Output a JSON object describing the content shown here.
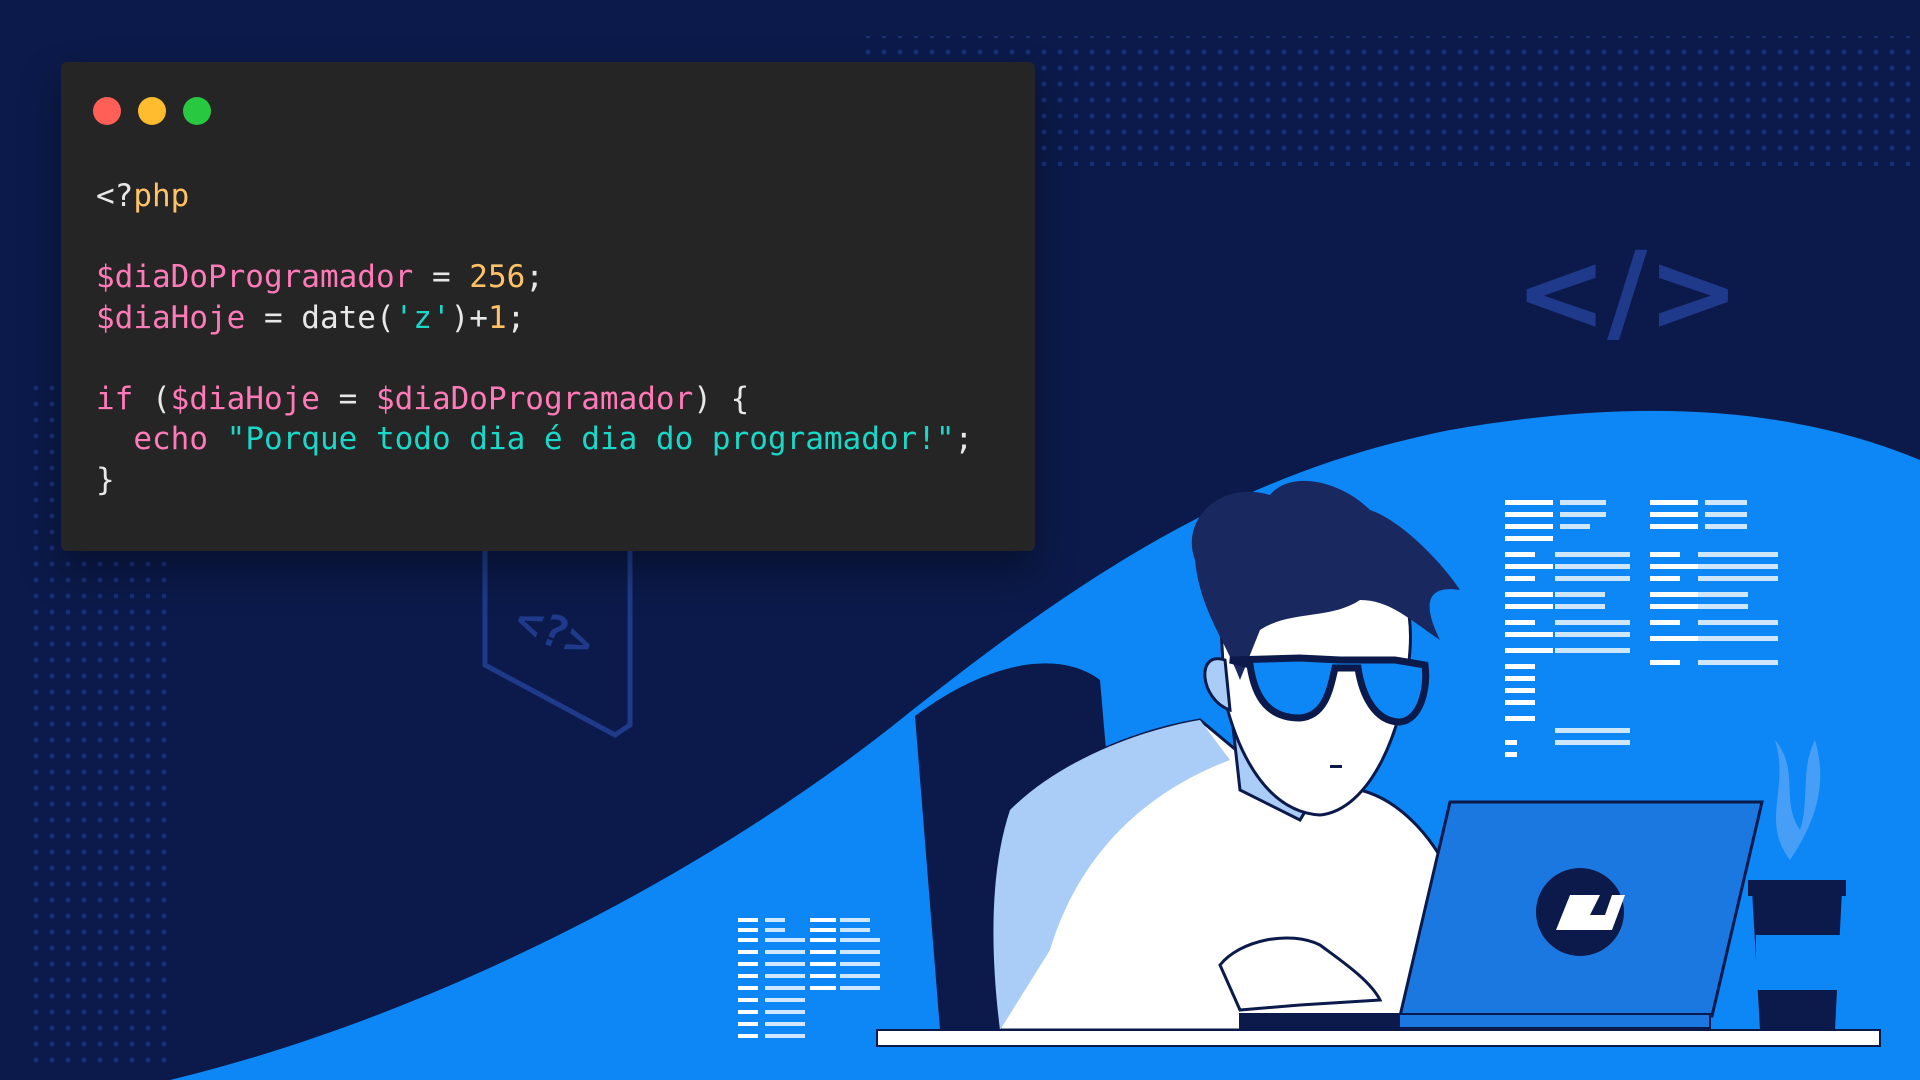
{
  "colors": {
    "background_dark": "#0b1a4a",
    "background_blue": "#0c87f5",
    "code_window_bg": "#252526",
    "dot_red": "#ff5f57",
    "dot_yellow": "#febc2e",
    "dot_green": "#28c840",
    "code_default": "#e8e8e8",
    "code_keyword": "#ff7ab6",
    "code_variable": "#ff7ab6",
    "code_number": "#ffc266",
    "code_string": "#19d8c8",
    "code_tag": "#ffc266"
  },
  "icons": [
    "close-dot-icon",
    "minimize-dot-icon",
    "maximize-dot-icon",
    "code-brackets-icon",
    "php-file-icon",
    "brand-logo-icon",
    "coffee-cup-icon"
  ],
  "code_window": {
    "lines": [
      [
        {
          "t": "<?",
          "c": "code_default"
        },
        {
          "t": "php",
          "c": "code_tag"
        }
      ],
      [],
      [
        {
          "t": "$diaDoProgramador",
          "c": "code_variable"
        },
        {
          "t": " = ",
          "c": "code_default"
        },
        {
          "t": "256",
          "c": "code_number"
        },
        {
          "t": ";",
          "c": "code_default"
        }
      ],
      [
        {
          "t": "$diaHoje",
          "c": "code_variable"
        },
        {
          "t": " = date(",
          "c": "code_default"
        },
        {
          "t": "'z'",
          "c": "code_string"
        },
        {
          "t": ")+",
          "c": "code_default"
        },
        {
          "t": "1",
          "c": "code_number"
        },
        {
          "t": ";",
          "c": "code_default"
        }
      ],
      [],
      [
        {
          "t": "if",
          "c": "code_keyword"
        },
        {
          "t": " (",
          "c": "code_default"
        },
        {
          "t": "$diaHoje",
          "c": "code_variable"
        },
        {
          "t": " = ",
          "c": "code_default"
        },
        {
          "t": "$diaDoProgramador",
          "c": "code_variable"
        },
        {
          "t": ") {",
          "c": "code_default"
        }
      ],
      [
        {
          "t": "  ",
          "c": "code_default"
        },
        {
          "t": "echo",
          "c": "code_keyword"
        },
        {
          "t": " ",
          "c": "code_default"
        },
        {
          "t": "\"Porque todo dia é dia do programador!\"",
          "c": "code_string"
        },
        {
          "t": ";",
          "c": "code_default"
        }
      ],
      [
        {
          "t": "}",
          "c": "code_default"
        }
      ]
    ]
  },
  "decor": {
    "code_brackets_symbol": "</>",
    "php_file_symbol": "<?>"
  }
}
